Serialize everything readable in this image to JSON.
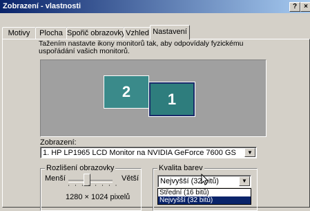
{
  "window": {
    "title": "Zobrazení - vlastnosti",
    "help_label": "?",
    "close_label": "×"
  },
  "tabs": [
    {
      "label": "Motivy"
    },
    {
      "label": "Plocha"
    },
    {
      "label": "Spořič obrazovky"
    },
    {
      "label": "Vzhled"
    },
    {
      "label": "Nastavení"
    }
  ],
  "settings": {
    "instruction": "Tažením nastavte ikony monitorů tak, aby odpovídaly fyzickému uspořádání vašich monitorů.",
    "monitors": [
      {
        "label": "2"
      },
      {
        "label": "1"
      }
    ],
    "display_label": "Zobrazení:",
    "display_value": "1. HP LP1965 LCD Monitor na NVIDIA GeForce 7600 GS",
    "resolution": {
      "title": "Rozlišení obrazovky",
      "less_label": "Menší",
      "more_label": "Větší",
      "value": "1280 × 1024 pixelů",
      "slider_fraction": 0.5
    },
    "color": {
      "title": "Kvalita barev",
      "selected": "Nejvyšší (32 bitů)",
      "options": [
        "Střední (16 bitů)",
        "Nejvyšší (32 bitů)"
      ]
    }
  }
}
